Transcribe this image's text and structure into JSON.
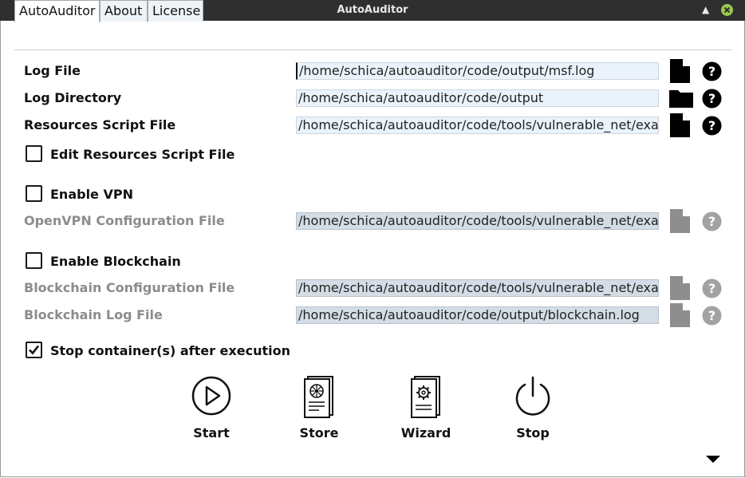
{
  "window": {
    "title": "AutoAuditor"
  },
  "tabs": [
    {
      "label": "AutoAuditor",
      "active": true
    },
    {
      "label": "About",
      "active": false
    },
    {
      "label": "License",
      "active": false
    }
  ],
  "rows": {
    "log_file": {
      "label": "Log File",
      "value": "/home/schica/autoauditor/code/output/msf.log",
      "icon": "file-icon",
      "enabled": true
    },
    "log_directory": {
      "label": "Log Directory",
      "value": "/home/schica/autoauditor/code/output",
      "icon": "folder-icon",
      "enabled": true
    },
    "resources_script": {
      "label": "Resources Script File",
      "value": "/home/schica/autoauditor/code/tools/vulnerable_net/examples/rc.json",
      "icon": "file-icon",
      "enabled": true
    },
    "openvpn_config": {
      "label": "OpenVPN Configuration File",
      "value": "/home/schica/autoauditor/code/tools/vulnerable_net/examples/client.ovpn",
      "icon": "file-icon",
      "enabled": false
    },
    "blockchain_config": {
      "label": "Blockchain Configuration File",
      "value": "/home/schica/autoauditor/code/tools/vulnerable_net/examples/network.yaml",
      "icon": "file-icon",
      "enabled": false
    },
    "blockchain_log": {
      "label": "Blockchain Log File",
      "value": "/home/schica/autoauditor/code/output/blockchain.log",
      "icon": "file-icon",
      "enabled": false
    }
  },
  "checkboxes": {
    "edit_resources": {
      "label": "Edit Resources Script File",
      "checked": false
    },
    "enable_vpn": {
      "label": "Enable VPN",
      "checked": false
    },
    "enable_blockchain": {
      "label": "Enable Blockchain",
      "checked": false
    },
    "stop_containers": {
      "label": "Stop container(s) after execution",
      "checked": true
    }
  },
  "actions": [
    {
      "label": "Start",
      "icon": "play-circle-icon"
    },
    {
      "label": "Store",
      "icon": "store-document-icon"
    },
    {
      "label": "Wizard",
      "icon": "wizard-document-icon"
    },
    {
      "label": "Stop",
      "icon": "power-icon"
    }
  ],
  "colors": {
    "titlebar": "#2f2f2f",
    "close_button": "#9bc850",
    "field_bg": "#eaf3fb",
    "field_disabled_bg": "#d4dde6",
    "disabled_text": "#8c8c8c"
  }
}
